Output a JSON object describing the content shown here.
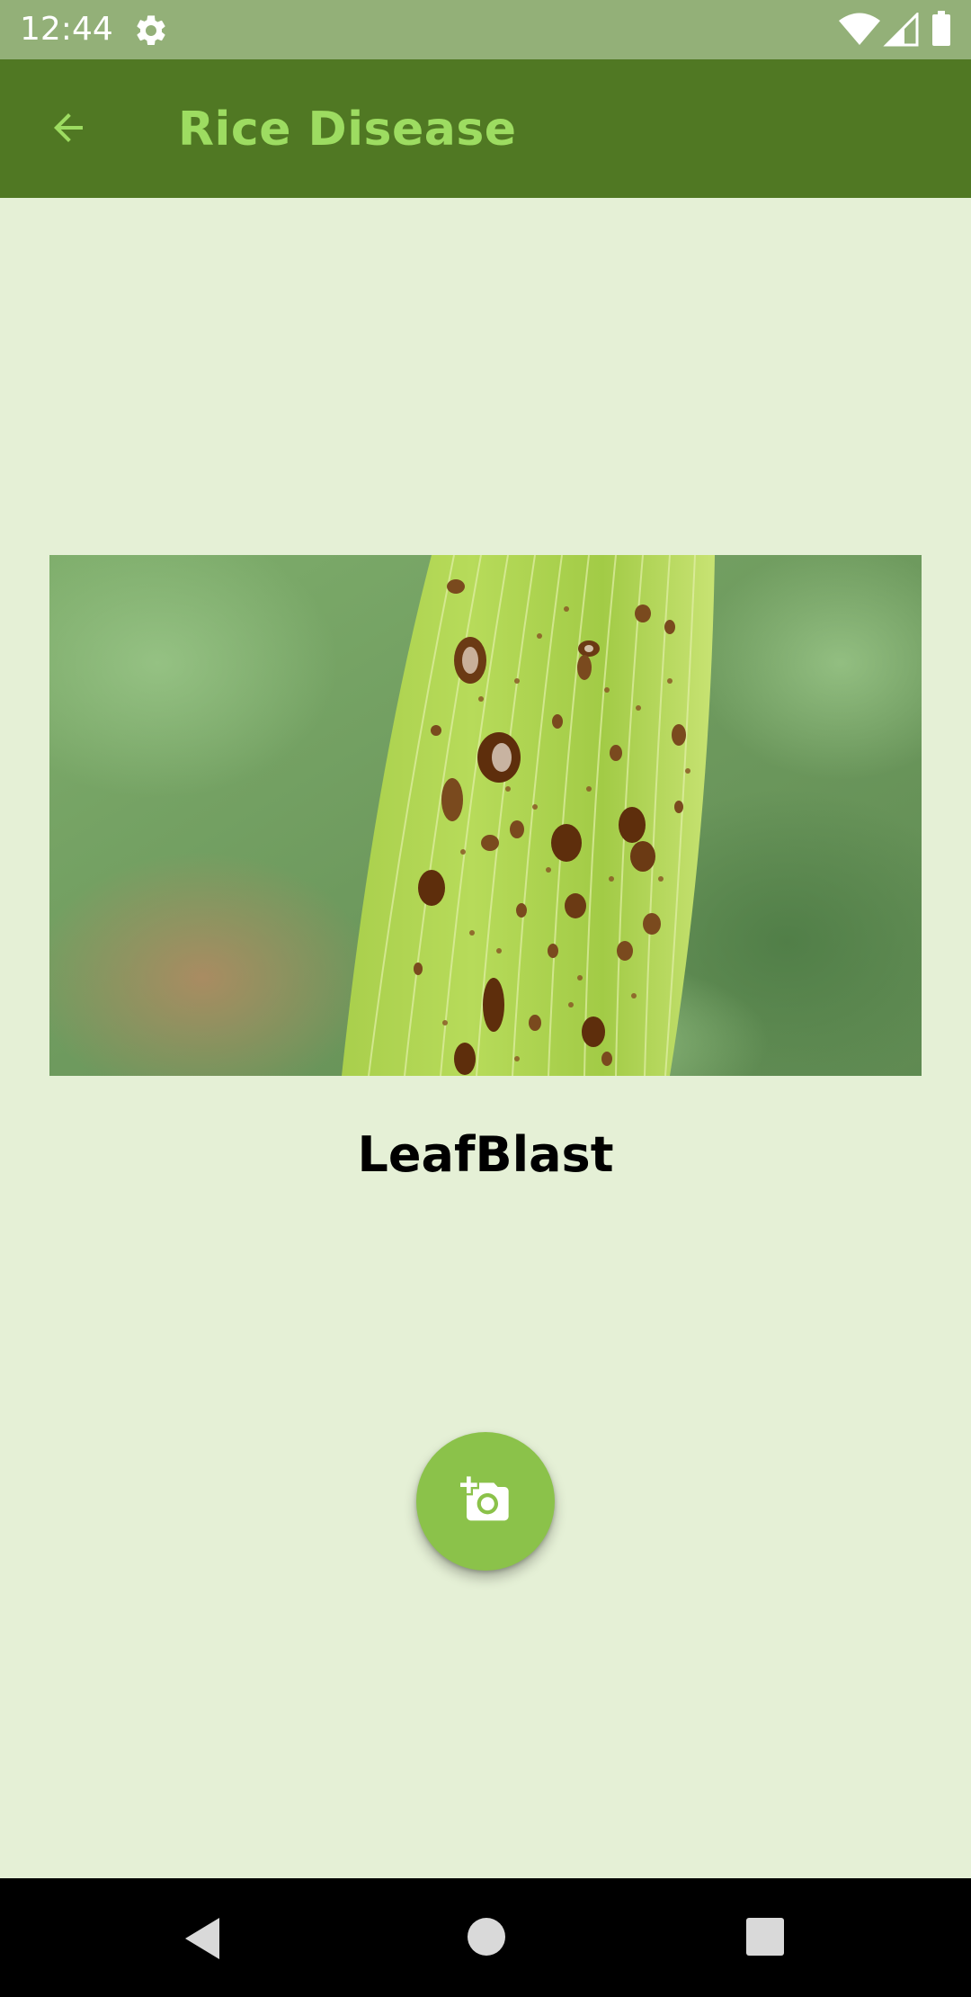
{
  "status_bar": {
    "time": "12:44",
    "icons": [
      "settings-icon",
      "wifi-icon",
      "signal-icon",
      "battery-icon"
    ]
  },
  "app_bar": {
    "title": "Rice Disease",
    "back_icon": "arrow-back-icon"
  },
  "main": {
    "image_subject": "leaf-photo",
    "result_label": "LeafBlast"
  },
  "fab": {
    "icon": "add-photo-camera-icon"
  },
  "nav_bar": {
    "icons": [
      "nav-back-icon",
      "nav-home-icon",
      "nav-recents-icon"
    ]
  },
  "colors": {
    "status_bar": "#93b078",
    "app_bar": "#507823",
    "title": "#9ddc61",
    "background": "#e5f0d6",
    "fab": "#8bc24a"
  }
}
